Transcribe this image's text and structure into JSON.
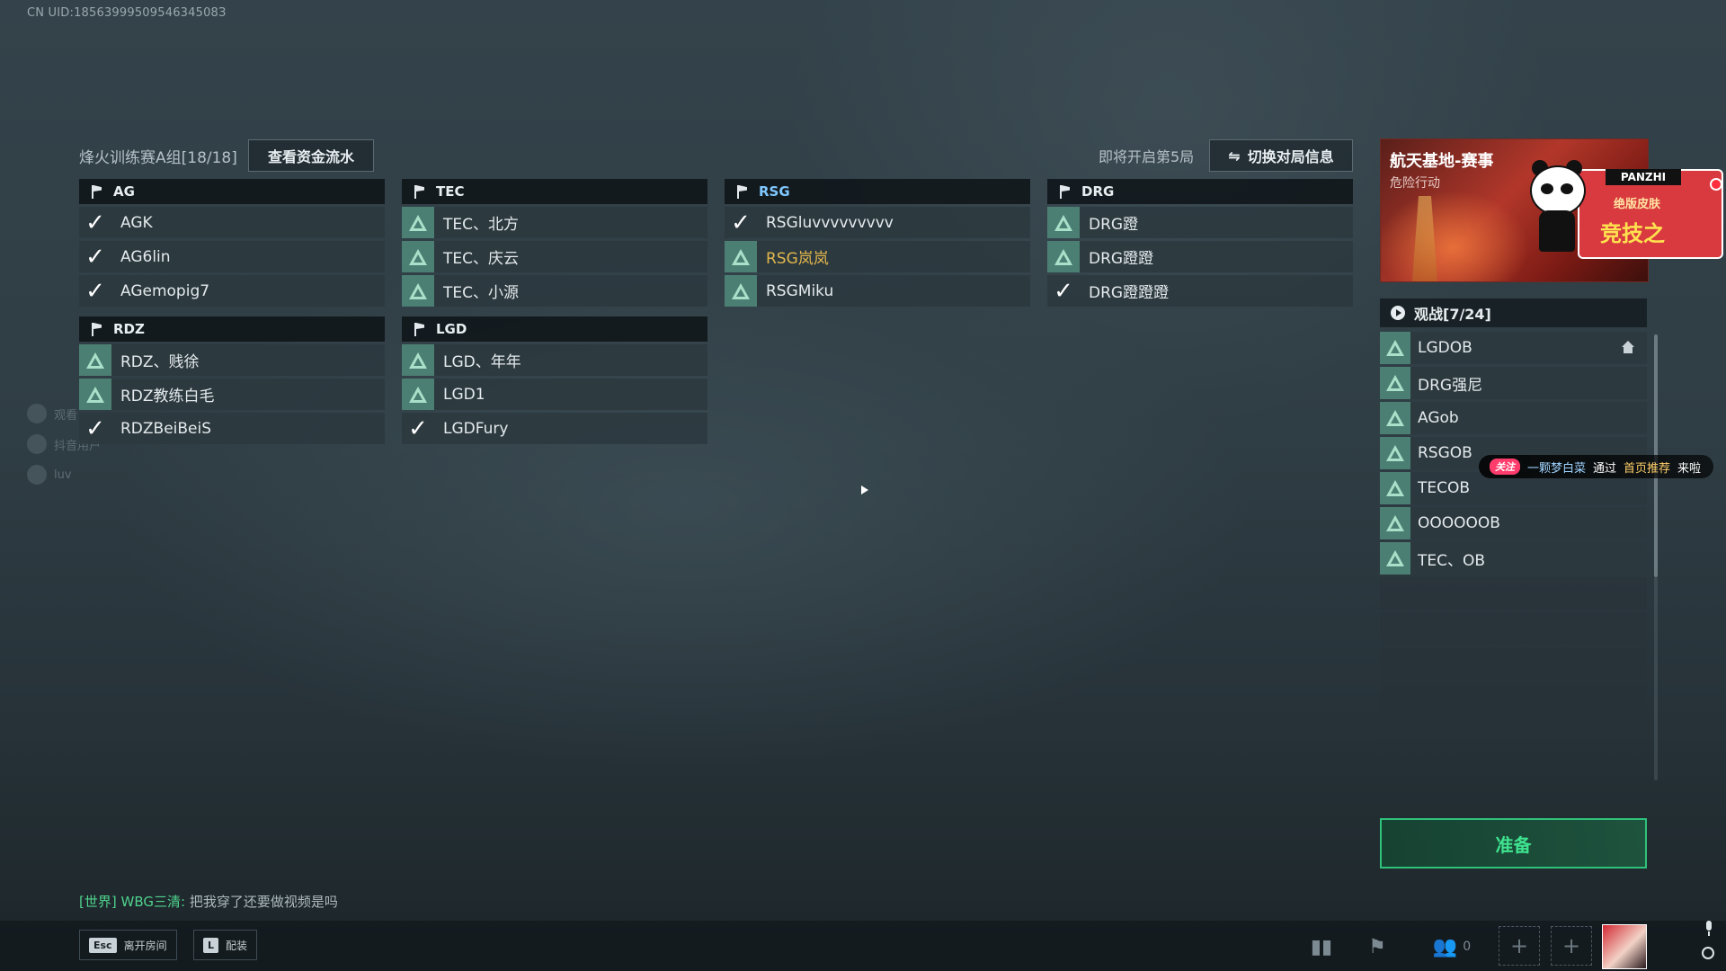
{
  "uid": "CN UID:1856399950954634508З",
  "header": {
    "group_title": "烽火训练赛A组[18/18]",
    "view_funds_label": "查看资金流水",
    "next_round": "即将开启第5局",
    "switch_match_label": "切换对局信息"
  },
  "teams": [
    {
      "name": "AG",
      "players": [
        {
          "name": "AGK",
          "status": "ready"
        },
        {
          "name": "AG6lin",
          "status": "ready"
        },
        {
          "name": "AGemopig7",
          "status": "ready"
        }
      ]
    },
    {
      "name": "TEC",
      "players": [
        {
          "name": "TEC、北方",
          "status": "pending"
        },
        {
          "name": "TEC、庆云",
          "status": "pending"
        },
        {
          "name": "TEC、小源",
          "status": "pending"
        }
      ]
    },
    {
      "name": "RSG",
      "players": [
        {
          "name": "RSGluvvvvvvvvv",
          "status": "ready"
        },
        {
          "name": "RSG岚岚",
          "status": "pending"
        },
        {
          "name": "RSGMiku",
          "status": "pending"
        }
      ]
    },
    {
      "name": "DRG",
      "players": [
        {
          "name": "DRG蹬",
          "status": "pending"
        },
        {
          "name": "DRG蹬蹬",
          "status": "pending"
        },
        {
          "name": "DRG蹬蹬蹬",
          "status": "ready"
        }
      ]
    },
    {
      "name": "RDZ",
      "players": [
        {
          "name": "RDZ、贱徐",
          "status": "pending"
        },
        {
          "name": "RDZ教练白毛",
          "status": "pending"
        },
        {
          "name": "RDZBeiBeiS",
          "status": "ready"
        }
      ]
    },
    {
      "name": "LGD",
      "players": [
        {
          "name": "LGD、年年",
          "status": "pending"
        },
        {
          "name": "LGD1",
          "status": "pending"
        },
        {
          "name": "LGDFury",
          "status": "ready"
        }
      ]
    }
  ],
  "event": {
    "title": "航天基地-赛事",
    "subtitle": "危险行动",
    "overlay_tag": "PANZHI",
    "overlay_line1": "绝版皮肤",
    "overlay_line2": "竞技之"
  },
  "spectators": {
    "header": "观战[7/24]",
    "list": [
      "LGDOB",
      "DRG强尼",
      "AGob",
      "RSGOB",
      "TECOB",
      "OOOOOOB",
      "TEC、OB"
    ]
  },
  "notification": {
    "follow": "关注",
    "user": "一颗梦白菜",
    "via": "通过",
    "source": "首页推荐",
    "tail": "来啦"
  },
  "ready_label": "准备",
  "chat": {
    "channel": "[世界]",
    "sender": "WBG三清:",
    "message": "把我穿了还要做视频是吗"
  },
  "bottom": {
    "leave_key": "Esc",
    "leave_label": "离开房间",
    "loadout_key": "L",
    "loadout_label": "配装",
    "friend_count": "0"
  },
  "side_streamers": [
    "观看",
    "抖音用户",
    "luv"
  ],
  "colors": {
    "ready_green": "#2ec27a",
    "pending_teal": "#4c7f73",
    "highlight_gold": "#e3b74c",
    "highlight_blue": "#7fc8ff"
  }
}
